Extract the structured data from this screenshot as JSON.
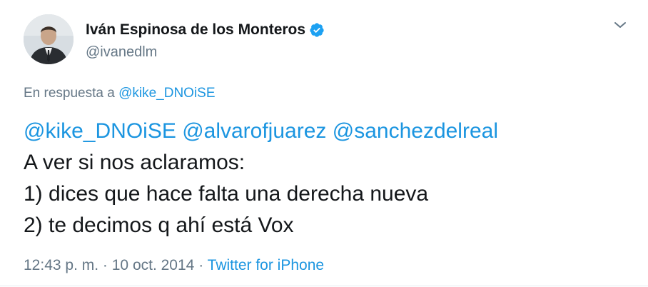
{
  "author": {
    "display_name": "Iván Espinosa de los Monteros",
    "handle": "@ivanedlm",
    "verified_icon": "verified-badge-icon",
    "verified_color": "#1da1f2"
  },
  "reply": {
    "prefix": "En respuesta a",
    "target": "@kike_DNOiSE"
  },
  "body": {
    "mentions": [
      "@kike_DNOiSE",
      "@alvarofjuarez",
      "@sanchezdelreal"
    ],
    "lines": [
      "A ver si nos aclaramos:",
      "1) dices que hace falta una derecha nueva",
      "2) te decimos q ahí está Vox"
    ]
  },
  "meta": {
    "time": "12:43 p. m.",
    "date": "10 oct. 2014",
    "separator": "·",
    "source": "Twitter for iPhone"
  },
  "colors": {
    "link": "#1b95e0",
    "secondary_text": "#657786",
    "primary_text": "#14171a"
  }
}
